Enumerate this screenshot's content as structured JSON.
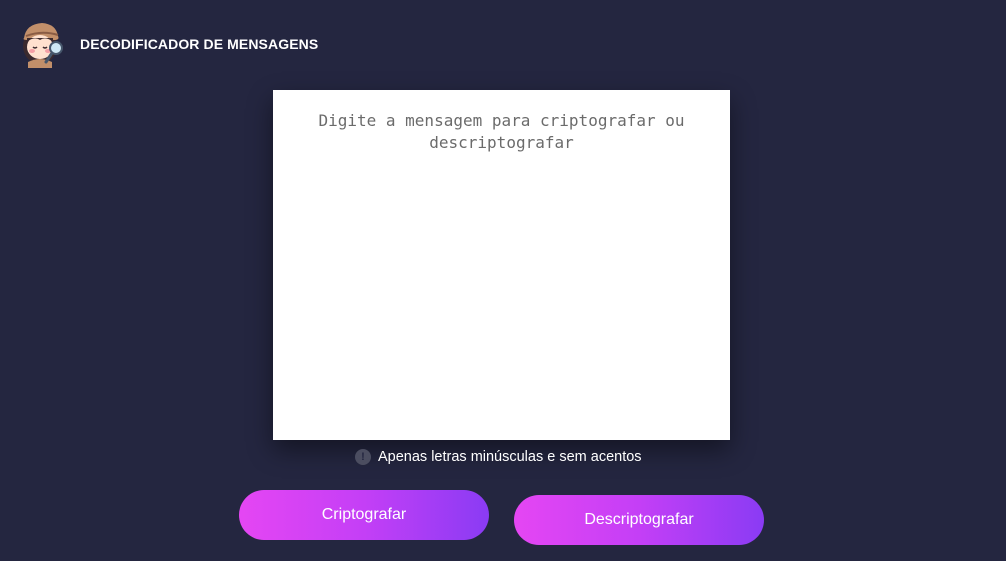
{
  "header": {
    "logo_icon": "detective-girl-avatar-icon",
    "title": "DECODIFICADOR DE MENSAGENS"
  },
  "editor": {
    "placeholder": "Digite a mensagem para criptografar ou descriptografar",
    "value": ""
  },
  "info": {
    "icon": "exclamation-circle-icon",
    "icon_glyph": "!",
    "text": "Apenas letras minúsculas e sem acentos"
  },
  "buttons": {
    "encrypt_label": "Criptografar",
    "decrypt_label": "Descriptografar"
  },
  "colors": {
    "background": "#242640",
    "gradient_start": "#e546f3",
    "gradient_end": "#8a3bf4"
  }
}
